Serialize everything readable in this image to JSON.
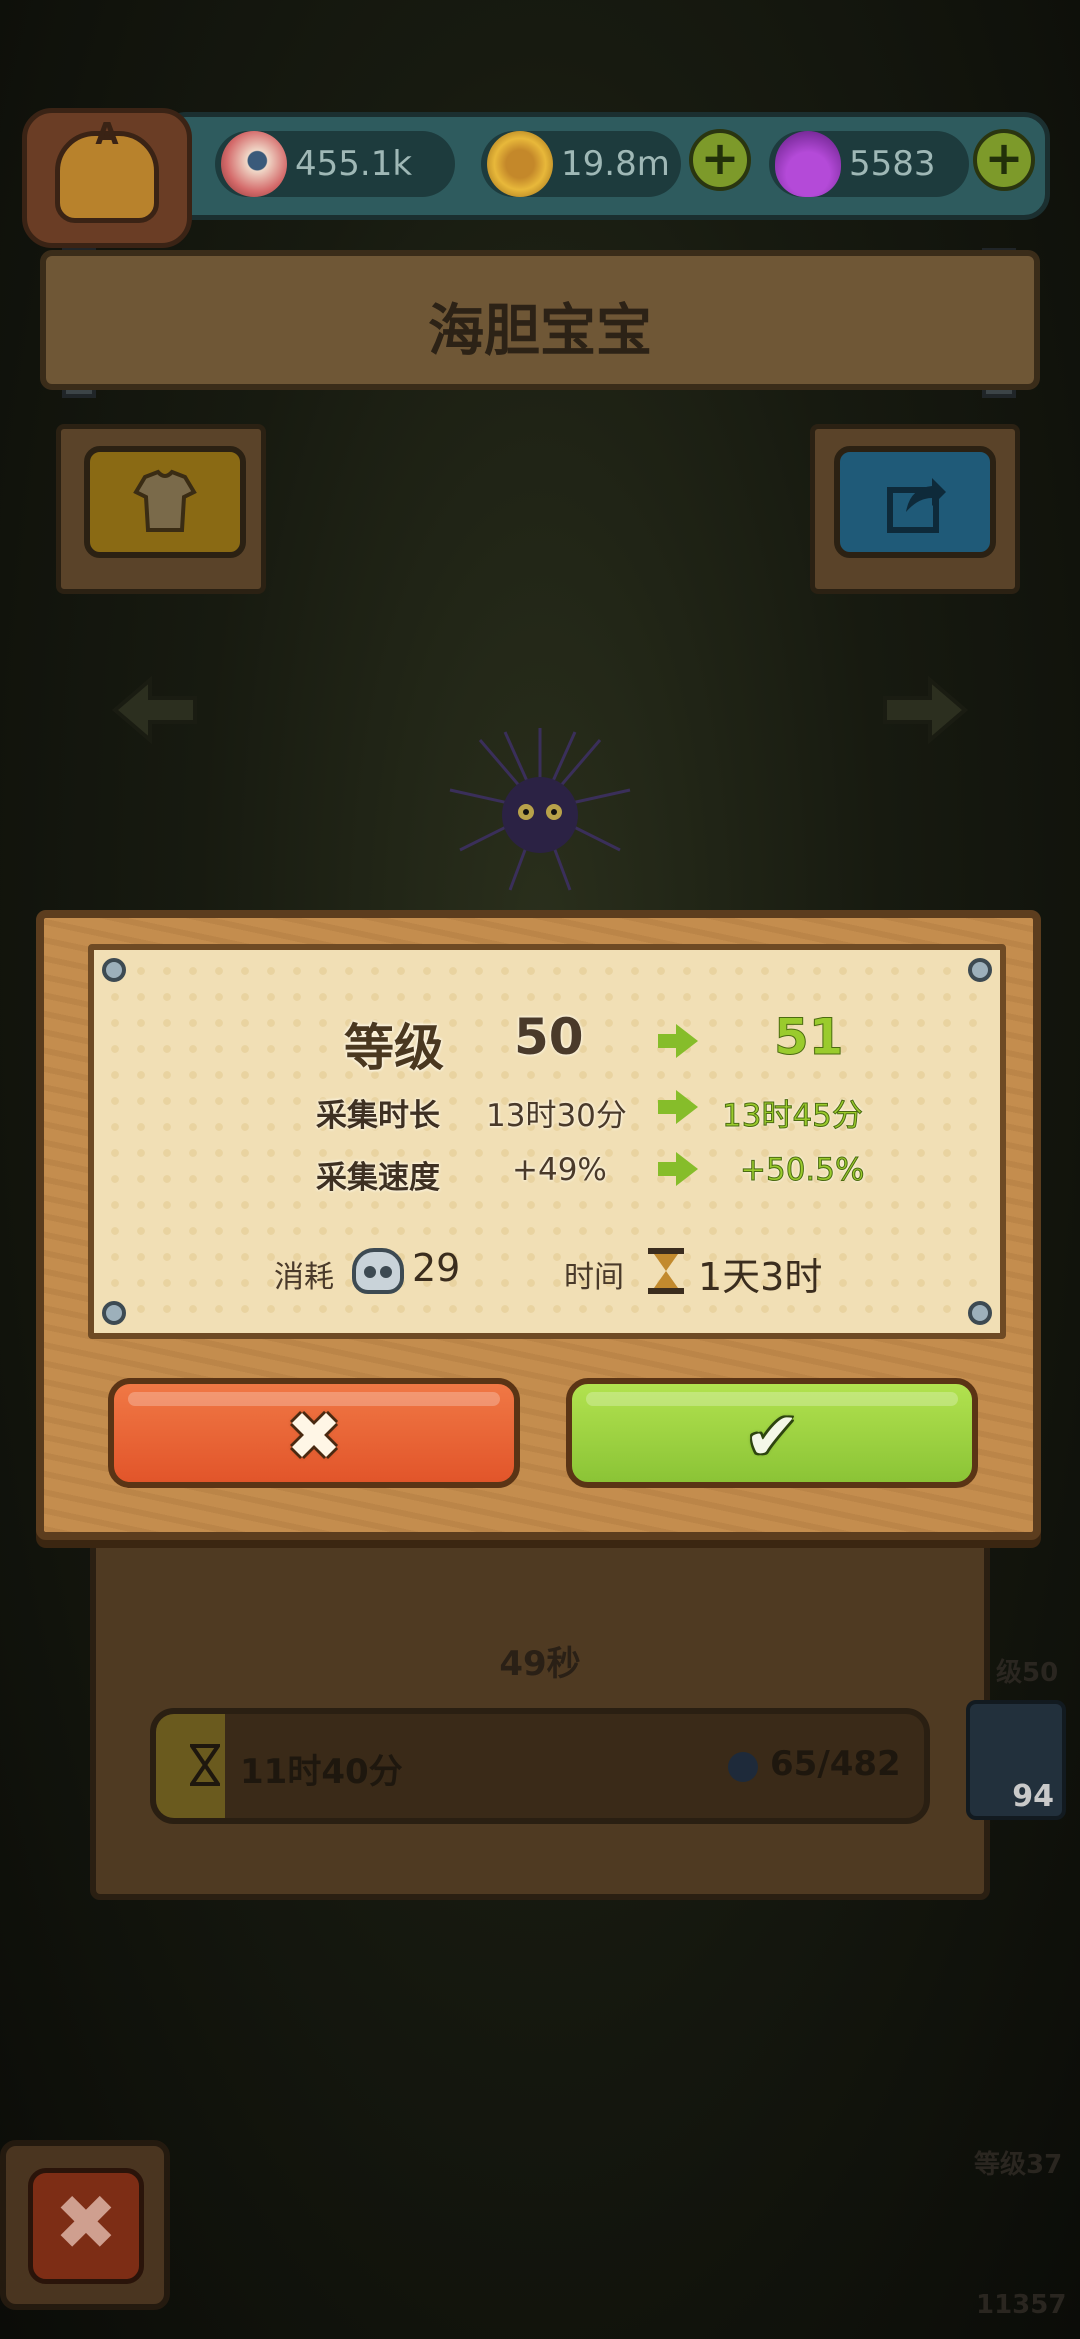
{
  "resources": {
    "eyeballs": "455.1k",
    "coins": "19.8m",
    "potions": "5583",
    "plus_symbol": "+"
  },
  "avatar_letter": "A",
  "creature_name": "海胆宝宝",
  "background": {
    "timer": "49秒",
    "progress_time": "11时40分",
    "progress_count": "65/482",
    "progress_fraction": 0.09,
    "side_level_1": "级50",
    "card_count": "94",
    "side_level_2": "等级37",
    "side_number": "11357"
  },
  "upgrade": {
    "level_label": "等级",
    "level_current": "50",
    "level_next": "51",
    "duration_label": "采集时长",
    "duration_current": "13时30分",
    "duration_next": "13时45分",
    "speed_label": "采集速度",
    "speed_current": "+49%",
    "speed_next": "+50.5%",
    "cost_label": "消耗",
    "cost_value": "29",
    "time_label": "时间",
    "time_value": "1天3时"
  },
  "buttons": {
    "cancel_glyph": "✖",
    "confirm_glyph": "✔",
    "close_glyph": "✖"
  },
  "colors": {
    "confirm_green": "#8bc436",
    "cancel_orange": "#e2552a",
    "next_value_green": "#9acb2d",
    "paper": "#f1dfb5",
    "wood": "#c48d4e"
  }
}
